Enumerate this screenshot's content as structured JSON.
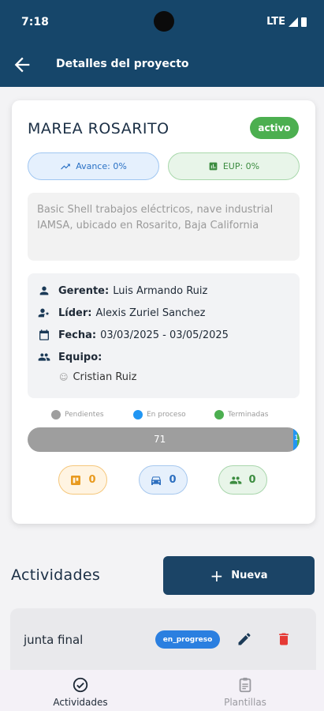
{
  "status_bar": {
    "time": "7:18",
    "network": "LTE"
  },
  "app_bar": {
    "title": "Detalles del proyecto"
  },
  "project": {
    "name": "MAREA ROSARITO",
    "status": "activo",
    "avance_label": "Avance: 0%",
    "eup_label": "EUP: 0%",
    "description": "Basic Shell trabajos eléctricos, nave industrial IAMSA, ubicado en Rosarito, Baja California",
    "gerente_label": "Gerente:",
    "gerente": "Luis Armando Ruiz",
    "lider_label": "Líder:",
    "lider": "Alexis Zuriel Sanchez",
    "fecha_label": "Fecha:",
    "fecha": "03/03/2025 - 03/05/2025",
    "equipo_label": "Equipo:",
    "equipo": [
      "Cristian Ruiz"
    ]
  },
  "progress": {
    "legend": [
      "Pendientes",
      "En proceso",
      "Terminadas"
    ],
    "colors": [
      "#9e9e9e",
      "#2196f3",
      "#4caf50"
    ],
    "pending_count": "71",
    "other_count": "1",
    "pending_fraction": 0.97,
    "in_progress_fraction": 0.015,
    "done_fraction": 0.01
  },
  "chips": [
    {
      "icon": "board-icon",
      "value": "0",
      "color": "#e89a1f"
    },
    {
      "icon": "car-icon",
      "value": "0",
      "color": "#2d6fbf"
    },
    {
      "icon": "group-icon",
      "value": "0",
      "color": "#3c8c40"
    }
  ],
  "activities": {
    "title": "Actividades",
    "new_button": "Nueva",
    "items": [
      {
        "name": "junta final",
        "status": "en_progreso"
      }
    ]
  },
  "bottom_nav": {
    "activities": "Actividades",
    "templates": "Plantillas"
  }
}
